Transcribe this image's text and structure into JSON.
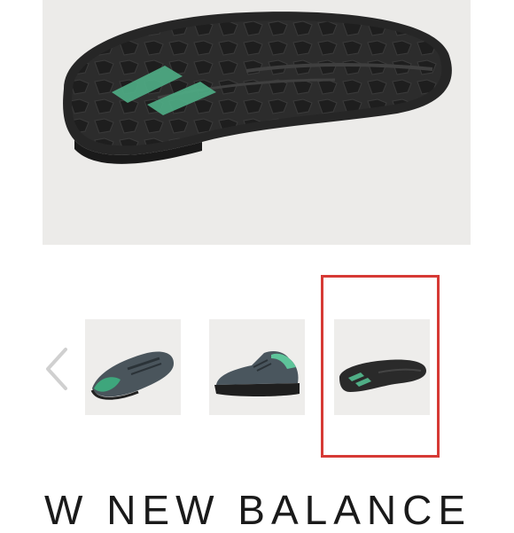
{
  "hero": {
    "alt_icon": "shoe-sole-image"
  },
  "gallery": {
    "prev_icon": "chevron-left-icon",
    "thumbnails": [
      {
        "icon": "shoe-top-view-image",
        "selected": false
      },
      {
        "icon": "shoe-side-view-image",
        "selected": false
      },
      {
        "icon": "shoe-sole-view-image",
        "selected": true
      }
    ],
    "selected_color": "#d63a35"
  },
  "product": {
    "title": "W NEW BALANCE"
  },
  "colors": {
    "accent_green": "#4fae86",
    "sole_dark": "#2a2a2a",
    "background": "#ecebe9"
  }
}
